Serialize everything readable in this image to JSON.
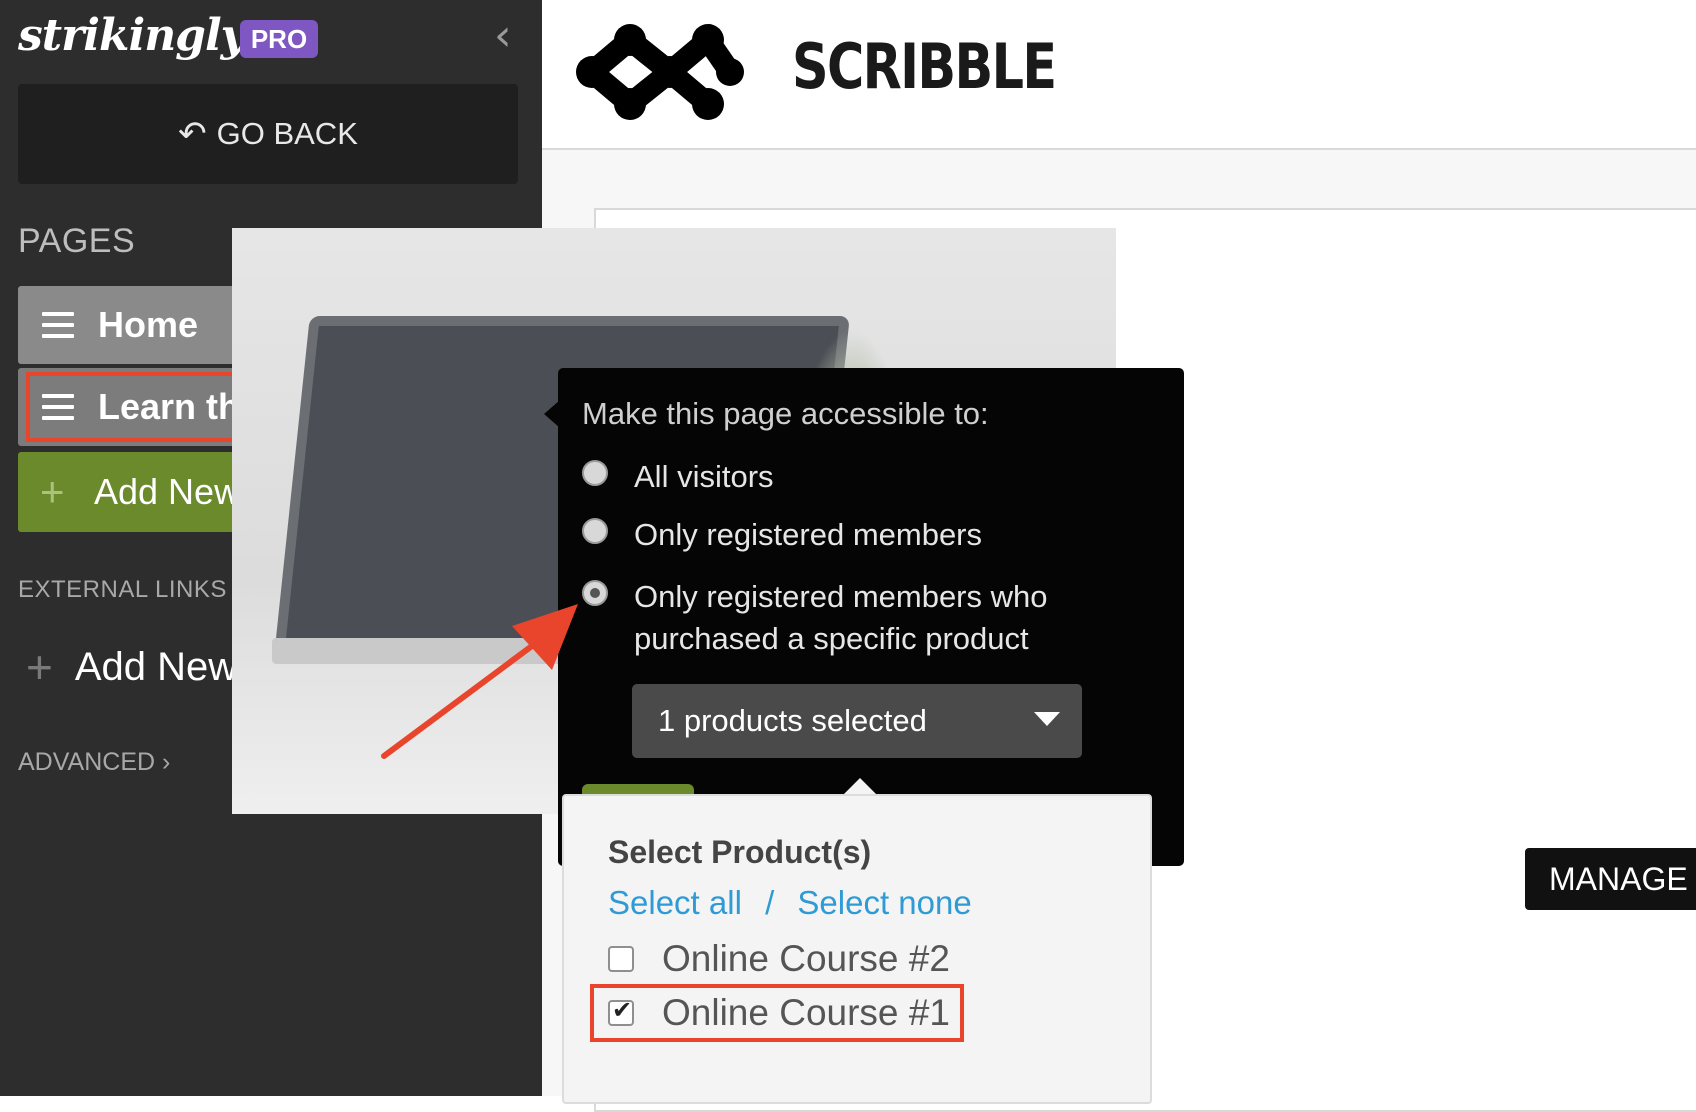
{
  "sidebar": {
    "brand": "strikingly",
    "badge": "PRO",
    "go_back": "GO BACK",
    "pages_title": "PAGES",
    "pages": [
      {
        "label": "Home"
      },
      {
        "label": "Learn the Basics"
      }
    ],
    "add_page": "Add New Page",
    "external_links_title": "EXTERNAL LINKS",
    "add_link": "Add New Link",
    "advanced": "ADVANCED"
  },
  "site": {
    "name": "SCRIBBLE",
    "manage_label": "MANAGE"
  },
  "access_popup": {
    "title": "Make this page accessible to:",
    "options": [
      {
        "label": "All visitors",
        "checked": false
      },
      {
        "label": "Only registered members",
        "checked": false
      },
      {
        "label_line1": "Only registered members who",
        "label_line2": "purchased a specific product",
        "checked": true
      }
    ],
    "select_value": "1 products selected"
  },
  "product_dropdown": {
    "title": "Select Product(s)",
    "select_all": "Select all",
    "separator": "/",
    "select_none": "Select none",
    "products": [
      {
        "label": "Online Course #2",
        "checked": false
      },
      {
        "label": "Online Course #1",
        "checked": true
      }
    ]
  },
  "colors": {
    "sidebar_bg": "#2d2d2d",
    "badge": "#7e57c2",
    "add_page_green": "#6a8a2c",
    "highlight_red": "#e8452c",
    "link_blue": "#2f9bd6"
  },
  "icons": [
    "undo-arrow-icon",
    "hamburger-icon",
    "home-icon",
    "gear-icon",
    "plus-icon",
    "chevron-left-icon",
    "chevron-right-icon",
    "caret-down-icon",
    "scribble-logo",
    "checkmark-icon"
  ]
}
